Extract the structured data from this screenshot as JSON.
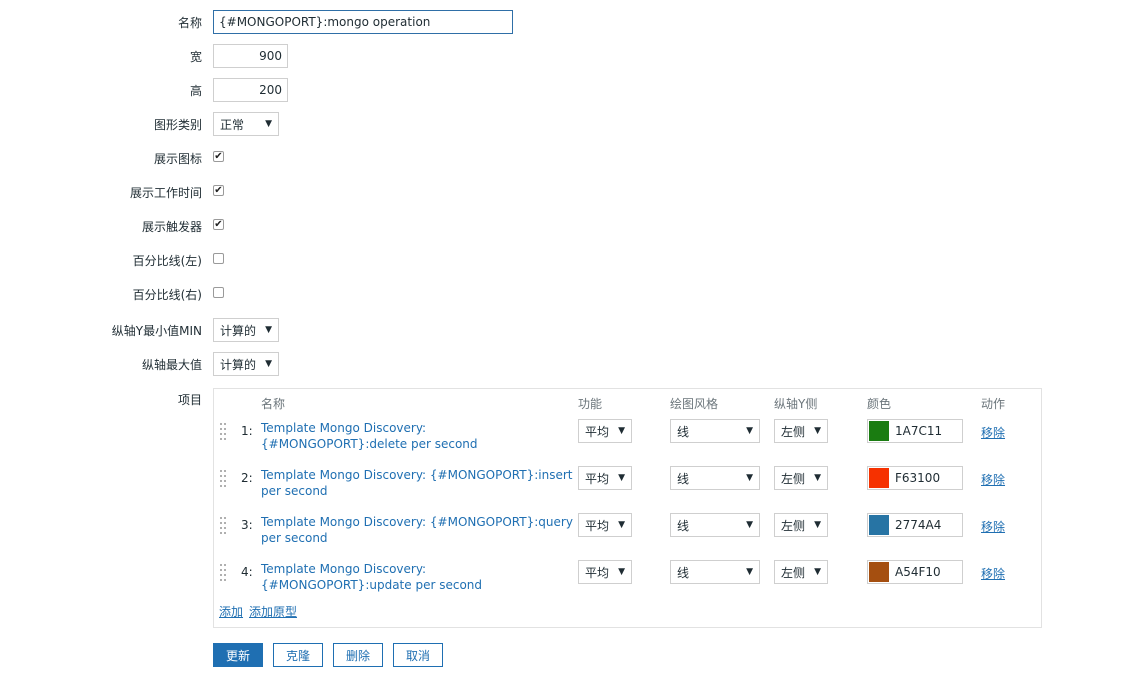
{
  "form": {
    "name_label": "名称",
    "name_value": "{#MONGOPORT}:mongo operation",
    "width_label": "宽",
    "width_value": "900",
    "height_label": "高",
    "height_value": "200",
    "graph_type_label": "图形类别",
    "graph_type_value": "正常",
    "show_legend_label": "展示图标",
    "show_legend": true,
    "show_work_period_label": "展示工作时间",
    "show_work_period": true,
    "show_triggers_label": "展示触发器",
    "show_triggers": true,
    "percentile_left_label": "百分比线(左)",
    "percentile_left": false,
    "percentile_right_label": "百分比线(右)",
    "percentile_right": false,
    "ymin_label": "纵轴Y最小值MIN",
    "ymin_value": "计算的",
    "ymax_label": "纵轴最大值",
    "ymax_value": "计算的",
    "items_label": "项目"
  },
  "items_table": {
    "headers": {
      "name": "名称",
      "function": "功能",
      "draw_style": "绘图风格",
      "y_axis": "纵轴Y侧",
      "color": "颜色",
      "action": "动作"
    },
    "rows": [
      {
        "index": "1:",
        "name": "Template Mongo Discovery: {#MONGOPORT}:delete per second",
        "function": "平均",
        "draw_style": "线",
        "y_axis": "左侧",
        "color": "1A7C11",
        "color_hex": "#1A7C11",
        "action": "移除"
      },
      {
        "index": "2:",
        "name": "Template Mongo Discovery: {#MONGOPORT}:insert per second",
        "function": "平均",
        "draw_style": "线",
        "y_axis": "左侧",
        "color": "F63100",
        "color_hex": "#F63100",
        "action": "移除"
      },
      {
        "index": "3:",
        "name": "Template Mongo Discovery: {#MONGOPORT}:query per second",
        "function": "平均",
        "draw_style": "线",
        "y_axis": "左侧",
        "color": "2774A4",
        "color_hex": "#2774A4",
        "action": "移除"
      },
      {
        "index": "4:",
        "name": "Template Mongo Discovery: {#MONGOPORT}:update per second",
        "function": "平均",
        "draw_style": "线",
        "y_axis": "左侧",
        "color": "A54F10",
        "color_hex": "#A54F10",
        "action": "移除"
      }
    ],
    "add_label": "添加",
    "add_prototype_label": "添加原型"
  },
  "buttons": {
    "update": "更新",
    "clone": "克隆",
    "delete": "删除",
    "cancel": "取消"
  },
  "colors": {
    "accent": "#1F6FB2",
    "link": "#1F6FB2"
  }
}
